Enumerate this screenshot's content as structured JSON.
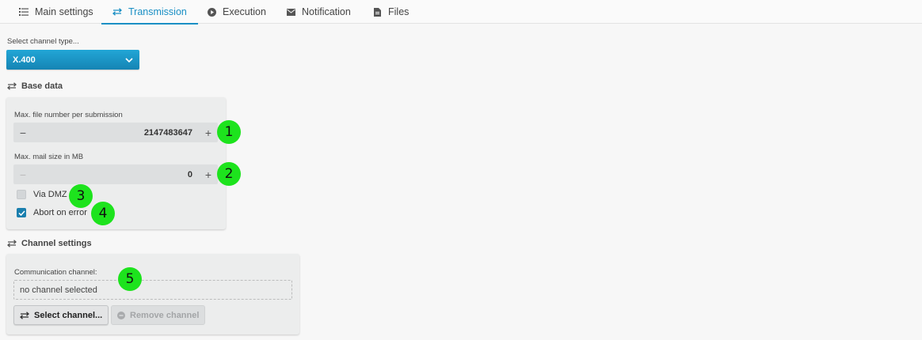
{
  "tabs": [
    {
      "label": "Main settings",
      "icon": "list-icon",
      "active": false
    },
    {
      "label": "Transmission",
      "icon": "transfer-arrows-icon",
      "active": true
    },
    {
      "label": "Execution",
      "icon": "play-icon",
      "active": false
    },
    {
      "label": "Notification",
      "icon": "envelope-icon",
      "active": false
    },
    {
      "label": "Files",
      "icon": "file-icon",
      "active": false
    }
  ],
  "channel_type": {
    "label": "Select channel type...",
    "value": "X.400"
  },
  "base_data": {
    "title": "Base data",
    "max_files": {
      "label": "Max. file number per submission",
      "value": "2147483647",
      "minus": "−",
      "plus": "+"
    },
    "max_mail": {
      "label": "Max. mail size in MB",
      "value": "0",
      "minus": "−",
      "plus": "+"
    },
    "via_dmz": {
      "label": "Via DMZ",
      "checked": false
    },
    "abort_on_error": {
      "label": "Abort on error",
      "checked": true
    }
  },
  "channel_settings": {
    "title": "Channel settings",
    "comm_label": "Communication channel:",
    "comm_value": "no channel selected",
    "select_button": "Select channel...",
    "remove_button": "Remove channel"
  },
  "markers": [
    "1",
    "2",
    "3",
    "4",
    "5"
  ],
  "colors": {
    "accent": "#1a8fc4",
    "marker": "#1de31d"
  }
}
